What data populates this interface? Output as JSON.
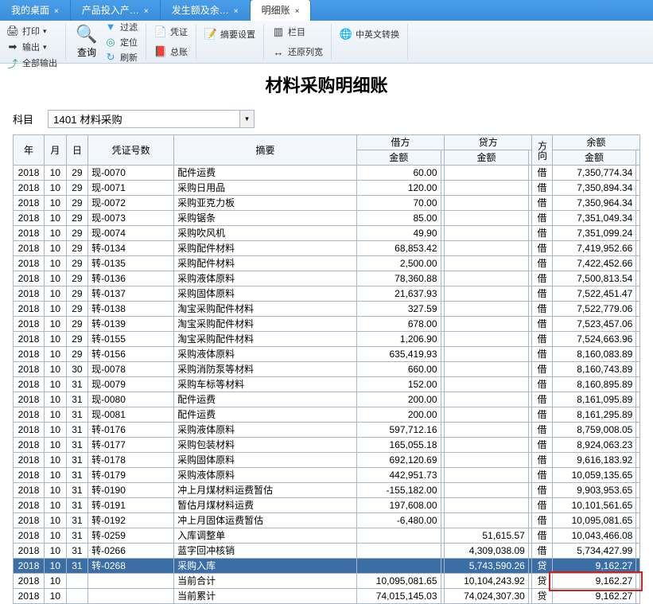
{
  "tabs": [
    {
      "label": "我的桌面",
      "active": false
    },
    {
      "label": "产品投入产…",
      "active": false
    },
    {
      "label": "发生额及余…",
      "active": false
    },
    {
      "label": "明细账",
      "active": true
    }
  ],
  "toolbar": {
    "print": "打印",
    "export": "输出",
    "output_all": "全部输出",
    "query": "查询",
    "filter": "过滤",
    "locate": "定位",
    "refresh": "刷新",
    "voucher": "凭证",
    "gl": "总账",
    "summary_set": "摘要设置",
    "column": "栏目",
    "reset_width": "还原列宽",
    "lang": "中英文转换"
  },
  "title": "材料采购明细账",
  "subject_label": "科目",
  "subject_value": "1401 材料采购",
  "headers": {
    "year": "年",
    "month": "月",
    "day": "日",
    "vno": "凭证号数",
    "summary": "摘要",
    "dr": "借方",
    "cr": "贷方",
    "amt": "金额",
    "dir": "方向",
    "bal": "余额"
  },
  "rows": [
    {
      "y": "2018",
      "m": "10",
      "d": "29",
      "vno": "现-0070",
      "sum": "配件运费",
      "dr": "60.00",
      "cr": "",
      "dir": "借",
      "bal": "7,350,774.34"
    },
    {
      "y": "2018",
      "m": "10",
      "d": "29",
      "vno": "现-0071",
      "sum": "采购日用品",
      "dr": "120.00",
      "cr": "",
      "dir": "借",
      "bal": "7,350,894.34"
    },
    {
      "y": "2018",
      "m": "10",
      "d": "29",
      "vno": "现-0072",
      "sum": "采购亚克力板",
      "dr": "70.00",
      "cr": "",
      "dir": "借",
      "bal": "7,350,964.34"
    },
    {
      "y": "2018",
      "m": "10",
      "d": "29",
      "vno": "现-0073",
      "sum": "采购锯条",
      "dr": "85.00",
      "cr": "",
      "dir": "借",
      "bal": "7,351,049.34"
    },
    {
      "y": "2018",
      "m": "10",
      "d": "29",
      "vno": "现-0074",
      "sum": "采购吹风机",
      "dr": "49.90",
      "cr": "",
      "dir": "借",
      "bal": "7,351,099.24"
    },
    {
      "y": "2018",
      "m": "10",
      "d": "29",
      "vno": "转-0134",
      "sum": "采购配件材料",
      "dr": "68,853.42",
      "cr": "",
      "dir": "借",
      "bal": "7,419,952.66"
    },
    {
      "y": "2018",
      "m": "10",
      "d": "29",
      "vno": "转-0135",
      "sum": "采购配件材料",
      "dr": "2,500.00",
      "cr": "",
      "dir": "借",
      "bal": "7,422,452.66"
    },
    {
      "y": "2018",
      "m": "10",
      "d": "29",
      "vno": "转-0136",
      "sum": "采购液体原料",
      "dr": "78,360.88",
      "cr": "",
      "dir": "借",
      "bal": "7,500,813.54"
    },
    {
      "y": "2018",
      "m": "10",
      "d": "29",
      "vno": "转-0137",
      "sum": "采购固体原料",
      "dr": "21,637.93",
      "cr": "",
      "dir": "借",
      "bal": "7,522,451.47"
    },
    {
      "y": "2018",
      "m": "10",
      "d": "29",
      "vno": "转-0138",
      "sum": "淘宝采购配件材料",
      "dr": "327.59",
      "cr": "",
      "dir": "借",
      "bal": "7,522,779.06"
    },
    {
      "y": "2018",
      "m": "10",
      "d": "29",
      "vno": "转-0139",
      "sum": "淘宝采购配件材料",
      "dr": "678.00",
      "cr": "",
      "dir": "借",
      "bal": "7,523,457.06"
    },
    {
      "y": "2018",
      "m": "10",
      "d": "29",
      "vno": "转-0155",
      "sum": "淘宝采购配件材料",
      "dr": "1,206.90",
      "cr": "",
      "dir": "借",
      "bal": "7,524,663.96"
    },
    {
      "y": "2018",
      "m": "10",
      "d": "29",
      "vno": "转-0156",
      "sum": "采购液体原料",
      "dr": "635,419.93",
      "cr": "",
      "dir": "借",
      "bal": "8,160,083.89"
    },
    {
      "y": "2018",
      "m": "10",
      "d": "30",
      "vno": "现-0078",
      "sum": "采购消防泵等材料",
      "dr": "660.00",
      "cr": "",
      "dir": "借",
      "bal": "8,160,743.89"
    },
    {
      "y": "2018",
      "m": "10",
      "d": "31",
      "vno": "现-0079",
      "sum": "采购车标等材料",
      "dr": "152.00",
      "cr": "",
      "dir": "借",
      "bal": "8,160,895.89"
    },
    {
      "y": "2018",
      "m": "10",
      "d": "31",
      "vno": "现-0080",
      "sum": "配件运费",
      "dr": "200.00",
      "cr": "",
      "dir": "借",
      "bal": "8,161,095.89"
    },
    {
      "y": "2018",
      "m": "10",
      "d": "31",
      "vno": "现-0081",
      "sum": "配件运费",
      "dr": "200.00",
      "cr": "",
      "dir": "借",
      "bal": "8,161,295.89"
    },
    {
      "y": "2018",
      "m": "10",
      "d": "31",
      "vno": "转-0176",
      "sum": "采购液体原料",
      "dr": "597,712.16",
      "cr": "",
      "dir": "借",
      "bal": "8,759,008.05"
    },
    {
      "y": "2018",
      "m": "10",
      "d": "31",
      "vno": "转-0177",
      "sum": "采购包装材料",
      "dr": "165,055.18",
      "cr": "",
      "dir": "借",
      "bal": "8,924,063.23"
    },
    {
      "y": "2018",
      "m": "10",
      "d": "31",
      "vno": "转-0178",
      "sum": "采购固体原料",
      "dr": "692,120.69",
      "cr": "",
      "dir": "借",
      "bal": "9,616,183.92"
    },
    {
      "y": "2018",
      "m": "10",
      "d": "31",
      "vno": "转-0179",
      "sum": "采购液体原料",
      "dr": "442,951.73",
      "cr": "",
      "dir": "借",
      "bal": "10,059,135.65"
    },
    {
      "y": "2018",
      "m": "10",
      "d": "31",
      "vno": "转-0190",
      "sum": "冲上月煤材料运费暂估",
      "dr": "-155,182.00",
      "cr": "",
      "dir": "借",
      "bal": "9,903,953.65"
    },
    {
      "y": "2018",
      "m": "10",
      "d": "31",
      "vno": "转-0191",
      "sum": "暂估月煤材料运费",
      "dr": "197,608.00",
      "cr": "",
      "dir": "借",
      "bal": "10,101,561.65"
    },
    {
      "y": "2018",
      "m": "10",
      "d": "31",
      "vno": "转-0192",
      "sum": "冲上月固体运费暂估",
      "dr": "-6,480.00",
      "cr": "",
      "dir": "借",
      "bal": "10,095,081.65"
    },
    {
      "y": "2018",
      "m": "10",
      "d": "31",
      "vno": "转-0259",
      "sum": "入库调整单",
      "dr": "",
      "cr": "51,615.57",
      "dir": "借",
      "bal": "10,043,466.08"
    },
    {
      "y": "2018",
      "m": "10",
      "d": "31",
      "vno": "转-0266",
      "sum": "蓝字回冲核销",
      "dr": "",
      "cr": "4,309,038.09",
      "dir": "借",
      "bal": "5,734,427.99"
    },
    {
      "y": "2018",
      "m": "10",
      "d": "31",
      "vno": "转-0268",
      "sum": "采购入库",
      "dr": "",
      "cr": "5,743,590.26",
      "dir": "贷",
      "bal": "9,162.27",
      "sel": true
    },
    {
      "y": "2018",
      "m": "10",
      "d": "",
      "vno": "",
      "sum": "当前合计",
      "dr": "10,095,081.65",
      "cr": "10,104,243.92",
      "dir": "贷",
      "bal": "9,162.27",
      "hl": true
    },
    {
      "y": "2018",
      "m": "10",
      "d": "",
      "vno": "",
      "sum": "当前累计",
      "dr": "74,015,145.03",
      "cr": "74,024,307.30",
      "dir": "贷",
      "bal": "9,162.27"
    }
  ]
}
